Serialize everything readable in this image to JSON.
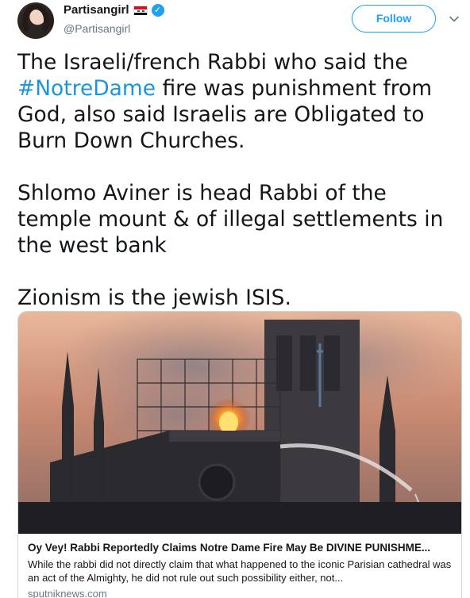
{
  "user": {
    "name": "Partisangirl",
    "handle": "@Partisangirl",
    "flag_icon": "syria-flag-icon",
    "verified_icon": "verified-badge-icon"
  },
  "actions": {
    "follow_label": "Follow",
    "menu_icon": "chevron-down-icon"
  },
  "tweet": {
    "paragraph1_before": "The Israeli/french Rabbi who said the ",
    "hashtag": "#NotreDame",
    "paragraph1_after": " fire was punishment from God, also said Israelis are Obligated to Burn Down Churches.",
    "paragraph2": "Shlomo Aviner is head Rabbi of the temple mount & of illegal settlements in the west bank",
    "paragraph3": "Zionism is the jewish ISIS."
  },
  "card": {
    "title": "Oy Vey! Rabbi Reportedly Claims Notre Dame Fire May Be DIVINE PUNISHME...",
    "description": "While the rabbi did not directly claim that what happened to the iconic Parisian cathedral was an act of the Almighty, he did not rule out such possibility either, not...",
    "domain": "sputniknews.com"
  },
  "colors": {
    "accent": "#1da1f2",
    "hashtag": "#1b95e0",
    "text": "#14171a",
    "secondary": "#657786"
  }
}
